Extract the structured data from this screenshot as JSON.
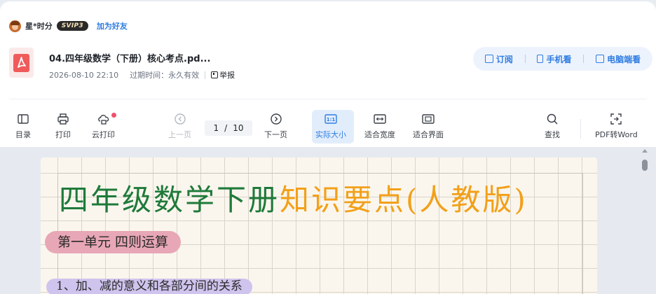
{
  "user": {
    "name": "星*时分",
    "badge": "SVIP3",
    "add_friend": "加为好友"
  },
  "file": {
    "title": "04.四年级数学（下册）核心考点.pd...",
    "date": "2026-08-10 22:10",
    "expire": "过期时间：永久有效",
    "report": "举报"
  },
  "actions": {
    "subscribe": "订阅",
    "mobile": "手机看",
    "desktop": "电脑端看"
  },
  "toolbar": {
    "toc": "目录",
    "print": "打印",
    "cloud_print": "云打印",
    "prev": "上一页",
    "page_current": "1",
    "page_sep": "/",
    "page_total": "10",
    "next": "下一页",
    "actual_size": "实际大小",
    "fit_width": "适合宽度",
    "fit_page": "适合界面",
    "find": "查找",
    "pdf_to_word": "PDF转Word"
  },
  "document": {
    "title_part1": "四年级数学下册",
    "title_part2": "知识要点(人教版)",
    "unit_heading": "第一单元 四则运算",
    "section_heading": "1、加、减的意义和各部分间的关系"
  },
  "colors": {
    "accent": "#2f7de1",
    "title_green": "#1f7a3a",
    "title_orange": "#f2a019",
    "unit_highlight": "#e8a7b6",
    "section_highlight": "#cfc4ee"
  }
}
